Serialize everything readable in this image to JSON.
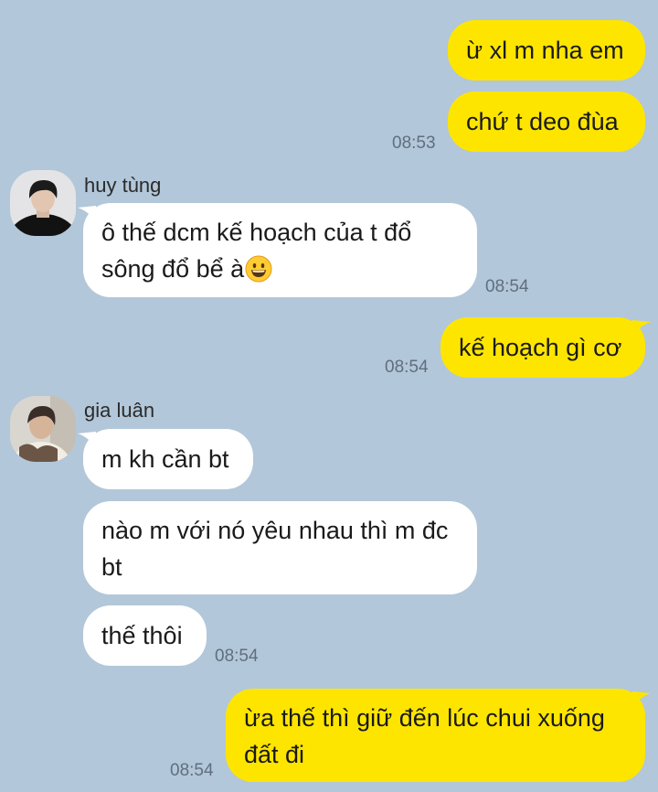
{
  "messages": [
    {
      "text": "ừ xl m nha em"
    },
    {
      "text": "chứ t deo đùa",
      "time": "08:53"
    },
    {
      "sender": "huy tùng",
      "text": "ô thế dcm kế hoạch của t đổ sông đổ bể à",
      "emoji": "grinning-face-emoji",
      "time": "08:54"
    },
    {
      "text": "kế hoạch gì cơ",
      "time": "08:54"
    },
    {
      "sender": "gia luân",
      "text": "m kh cần bt"
    },
    {
      "text": "nào m với nó yêu nhau thì m đc bt"
    },
    {
      "text": "thế thôi",
      "time": "08:54"
    },
    {
      "text": "ừa thế thì giữ đến lúc chui xuống đất đi",
      "time": "08:54"
    }
  ],
  "colors": {
    "background": "#b2c7d9",
    "outgoing_bubble": "#fee500",
    "incoming_bubble": "#ffffff",
    "timestamp": "#5f6f7e"
  }
}
